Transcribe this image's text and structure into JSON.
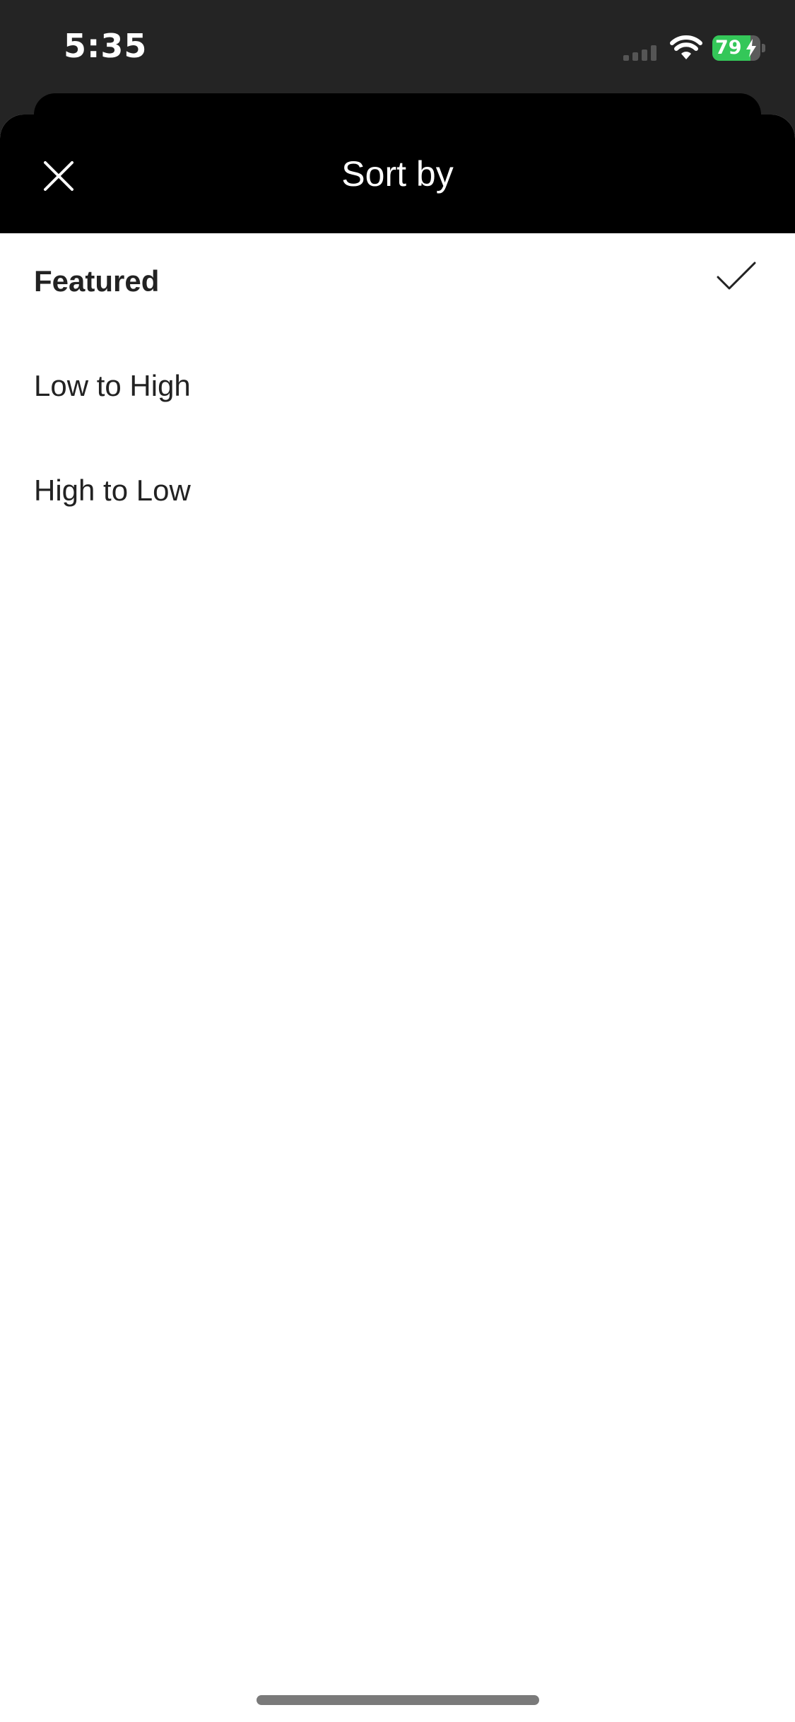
{
  "status_bar": {
    "time": "5:35",
    "battery_text": "79",
    "battery_level_percent": 79,
    "signal_icon": "cellular-signal-icon",
    "wifi_icon": "wifi-icon",
    "charging_icon": "bolt-icon"
  },
  "sheet": {
    "title": "Sort by",
    "close_icon": "close-icon",
    "options": [
      {
        "label": "Featured",
        "selected": true
      },
      {
        "label": "Low to High",
        "selected": false
      },
      {
        "label": "High to Low",
        "selected": false
      }
    ],
    "selected_icon": "checkmark-icon"
  },
  "colors": {
    "background": "#242424",
    "header": "#000000",
    "sheet": "#ffffff",
    "battery_fill": "#34c759"
  }
}
